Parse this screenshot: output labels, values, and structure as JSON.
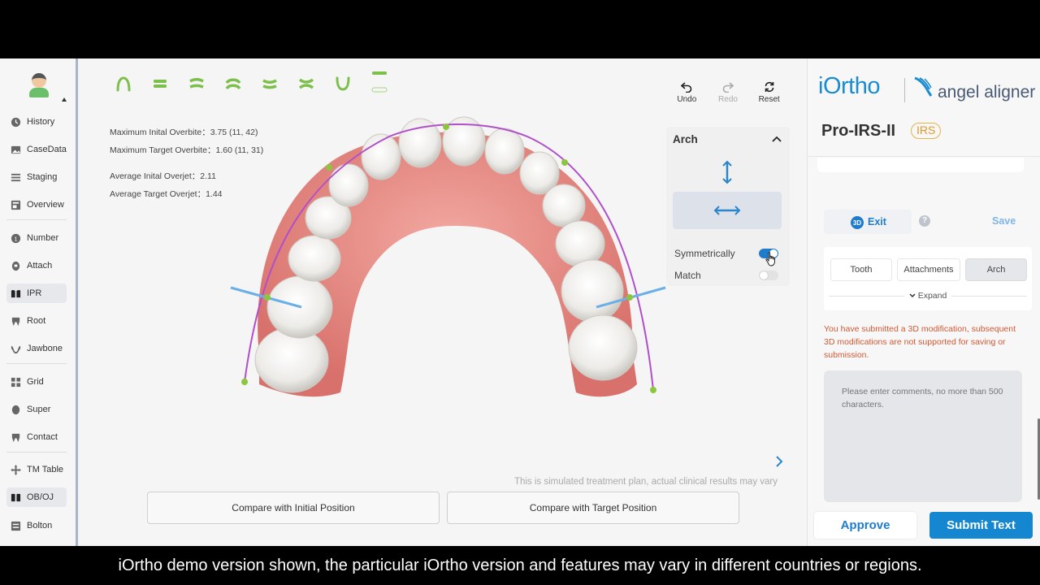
{
  "sidebar": {
    "items": [
      {
        "label": "History",
        "icon": "clock-icon"
      },
      {
        "label": "CaseData",
        "icon": "image-icon"
      },
      {
        "label": "Staging",
        "icon": "list-icon"
      },
      {
        "label": "Overview",
        "icon": "overview-icon"
      },
      {
        "label": "Number",
        "icon": "number-icon"
      },
      {
        "label": "Attach",
        "icon": "attach-icon"
      },
      {
        "label": "IPR",
        "icon": "ipr-icon"
      },
      {
        "label": "Root",
        "icon": "root-icon"
      },
      {
        "label": "Jawbone",
        "icon": "jawbone-icon"
      },
      {
        "label": "Grid",
        "icon": "grid-icon"
      },
      {
        "label": "Super",
        "icon": "super-icon"
      },
      {
        "label": "Contact",
        "icon": "contact-icon"
      },
      {
        "label": "TM Table",
        "icon": "move-icon"
      },
      {
        "label": "OB/OJ",
        "icon": "obj-icon"
      },
      {
        "label": "Bolton",
        "icon": "bolton-icon"
      }
    ]
  },
  "stats": {
    "max_initial_overbite": "Maximum Inital Overbite：3.75 (11, 42)",
    "max_target_overbite": "Maximum Target Overbite：1.60 (11, 31)",
    "avg_initial_overjet": "Average Inital Overjet：2.11",
    "avg_target_overjet": "Average Target Overjet：1.44"
  },
  "toolbox": {
    "undo": "Undo",
    "redo": "Redo",
    "reset": "Reset"
  },
  "arch_panel": {
    "title": "Arch",
    "symmetrically_label": "Symmetrically",
    "symmetrically_on": true,
    "match_label": "Match",
    "match_on": false
  },
  "viewport": {
    "disclaimer": "This is simulated treatment plan, actual clinical results may vary",
    "compare_initial": "Compare with Initial Position",
    "compare_target": "Compare with Target Position"
  },
  "right_panel": {
    "brand": "iOrtho",
    "brand2": "angel aligner",
    "product": "Pro-IRS-II",
    "product_badge": "IRS",
    "exit_badge": "3D",
    "exit_label": "Exit",
    "help": "?",
    "save_label": "Save",
    "tabs": [
      "Tooth",
      "Attachments",
      "Arch"
    ],
    "active_tab": "Arch",
    "expand_label": "Expand",
    "warning": "You have submitted a 3D modification, subsequent 3D modifications are not supported for saving or submission.",
    "comments_placeholder": "Please enter comments, no more than 500 characters.",
    "approve_label": "Approve",
    "submit_label": "Submit Text"
  },
  "caption": "iOrtho demo version shown, the particular iOrtho version and features may vary in different countries or regions.",
  "colors": {
    "accent": "#1f7ccc",
    "arch_curve": "#b04fc9",
    "control_point": "#8cc63f",
    "warning": "#d05a35",
    "gum": "#e07f78"
  }
}
